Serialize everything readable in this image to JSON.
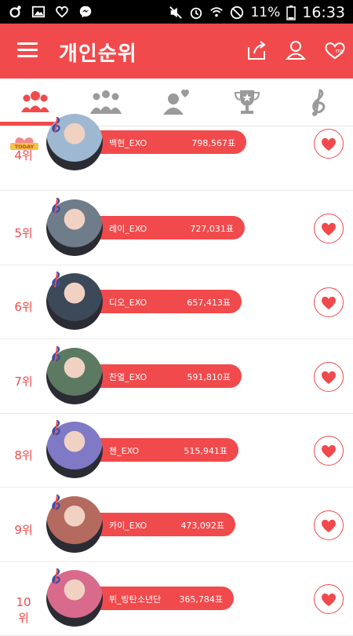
{
  "status_bar": {
    "battery": "11%",
    "time": "16:33"
  },
  "app": {
    "title": "개인순위"
  },
  "tabs": [
    "individual-ranking",
    "group-ranking",
    "fan-ranking",
    "trophy",
    "music"
  ],
  "badge": {
    "today": "TODAY"
  },
  "ranking": [
    {
      "rank": "4위",
      "name": "백현_EXO",
      "votes": "798,567표",
      "color": "#9fb8d2"
    },
    {
      "rank": "5위",
      "name": "레이_EXO",
      "votes": "727,031표",
      "color": "#6f7c8a"
    },
    {
      "rank": "6위",
      "name": "디오_EXO",
      "votes": "657,413표",
      "color": "#3c4958"
    },
    {
      "rank": "7위",
      "name": "찬열_EXO",
      "votes": "591,810표",
      "color": "#5c7a62"
    },
    {
      "rank": "8위",
      "name": "첸_EXO",
      "votes": "515,941표",
      "color": "#7f79c6"
    },
    {
      "rank": "9위",
      "name": "카이_EXO",
      "votes": "473,092표",
      "color": "#b46a5e"
    },
    {
      "rank": "10위",
      "name": "뷔_방탄소년단",
      "votes": "365,784표",
      "color": "#d86a8c"
    }
  ],
  "colors": {
    "accent": "#f14a4c",
    "tab_icon": "#9a9a9a"
  }
}
